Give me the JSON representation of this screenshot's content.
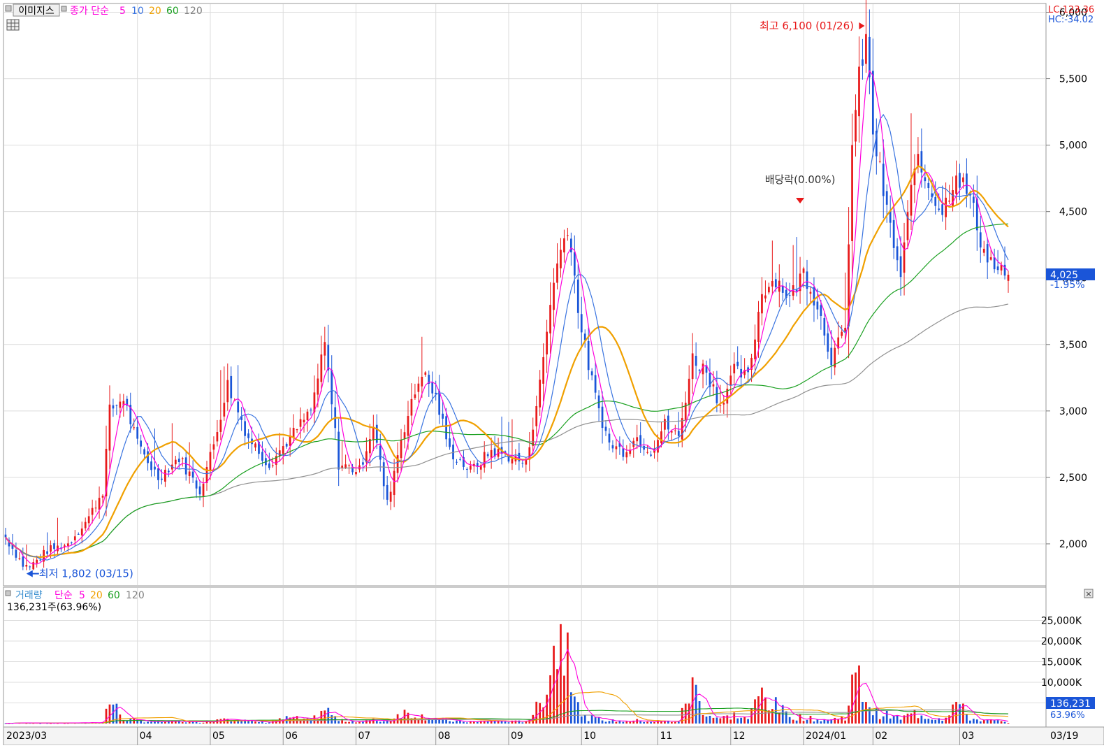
{
  "header": {
    "toggle_label": "이미지스",
    "price_label": "종가 단순",
    "ma": [
      "5",
      "10",
      "20",
      "60",
      "120"
    ],
    "lc": "LC:123.36",
    "hc": "HC:-34.02"
  },
  "volume_header": {
    "label": "거래량",
    "ma_label": "단순",
    "ma": [
      "5",
      "20",
      "60",
      "120"
    ],
    "current": "136,231주(63.96%)"
  },
  "colors": {
    "up": "#e8191a",
    "down": "#1a55d8",
    "ma5": "#ff00dd",
    "ma10": "#3a74e0",
    "ma20": "#f0a000",
    "ma60": "#1aa020",
    "ma120": "#909090",
    "grid": "#dcdcdc"
  },
  "chart_data": {
    "type": "candlestick",
    "price_axis": {
      "ylim": [
        1700,
        6050
      ],
      "ticks": [
        "2,000",
        "2,500",
        "3,000",
        "3,500",
        "4,000",
        "4,500",
        "5,000",
        "5,500",
        "6,000"
      ]
    },
    "volume_axis": {
      "ylim": [
        0,
        30000
      ],
      "unit": "K",
      "ticks": [
        "5,000K",
        "10,000K",
        "15,000K",
        "20,000K",
        "25,000K"
      ]
    },
    "x_labels": [
      "2023/03",
      "04",
      "05",
      "06",
      "07",
      "08",
      "09",
      "10",
      "11",
      "12",
      "2024/01",
      "02",
      "03",
      "03/19"
    ],
    "current": {
      "price": "4,025",
      "change": "-1.95%",
      "volume": "136,231",
      "volume_pct": "63.96%"
    },
    "annotations": {
      "high": "최고 6,100 (01/26)",
      "low": "최저 1,802 (03/15)",
      "dividend": "배당락(0.00%)"
    },
    "high_value": 6100,
    "low_value": 1802,
    "anchors": [
      [
        0,
        2050,
        80
      ],
      [
        6,
        1802,
        250
      ],
      [
        12,
        1950,
        150
      ],
      [
        18,
        2000,
        180
      ],
      [
        24,
        2200,
        250
      ],
      [
        28,
        2400,
        500
      ],
      [
        30,
        3000,
        7200
      ],
      [
        34,
        3100,
        1500
      ],
      [
        38,
        2750,
        800
      ],
      [
        44,
        2500,
        500
      ],
      [
        50,
        2650,
        600
      ],
      [
        56,
        2400,
        500
      ],
      [
        60,
        2750,
        900
      ],
      [
        64,
        3200,
        2400
      ],
      [
        70,
        2800,
        600
      ],
      [
        76,
        2600,
        400
      ],
      [
        82,
        2800,
        1800
      ],
      [
        88,
        3000,
        900
      ],
      [
        92,
        3500,
        4500
      ],
      [
        96,
        2600,
        900
      ],
      [
        102,
        2550,
        700
      ],
      [
        106,
        2900,
        1000
      ],
      [
        110,
        2300,
        700
      ],
      [
        114,
        2800,
        3500
      ],
      [
        120,
        3300,
        2200
      ],
      [
        124,
        3100,
        1500
      ],
      [
        128,
        2700,
        800
      ],
      [
        134,
        2550,
        500
      ],
      [
        140,
        2700,
        800
      ],
      [
        146,
        2650,
        600
      ],
      [
        150,
        2600,
        700
      ],
      [
        154,
        3200,
        5500
      ],
      [
        158,
        4000,
        23000
      ],
      [
        162,
        4400,
        28000
      ],
      [
        166,
        3600,
        1800
      ],
      [
        170,
        3100,
        1500
      ],
      [
        174,
        2750,
        900
      ],
      [
        178,
        2700,
        700
      ],
      [
        182,
        2800,
        900
      ],
      [
        186,
        2700,
        600
      ],
      [
        190,
        2900,
        700
      ],
      [
        194,
        2800,
        600
      ],
      [
        198,
        3400,
        11500
      ],
      [
        202,
        3300,
        2800
      ],
      [
        206,
        3050,
        1500
      ],
      [
        210,
        3300,
        2500
      ],
      [
        214,
        3250,
        1500
      ],
      [
        218,
        3900,
        9500
      ],
      [
        222,
        4000,
        5200
      ],
      [
        226,
        3850,
        2200
      ],
      [
        230,
        4050,
        1800
      ],
      [
        234,
        3800,
        1200
      ],
      [
        238,
        3400,
        1200
      ],
      [
        242,
        3600,
        2000
      ],
      [
        244,
        5000,
        11500
      ],
      [
        246,
        5500,
        12200
      ],
      [
        248,
        5800,
        8500
      ],
      [
        250,
        5100,
        3500
      ],
      [
        254,
        4500,
        2500
      ],
      [
        258,
        4000,
        1500
      ],
      [
        262,
        4900,
        3200
      ],
      [
        266,
        4700,
        2000
      ],
      [
        270,
        4500,
        1500
      ],
      [
        274,
        4800,
        6500
      ],
      [
        278,
        4600,
        1500
      ],
      [
        282,
        4200,
        1000
      ],
      [
        286,
        4050,
        800
      ],
      [
        289,
        4025,
        136
      ]
    ]
  }
}
